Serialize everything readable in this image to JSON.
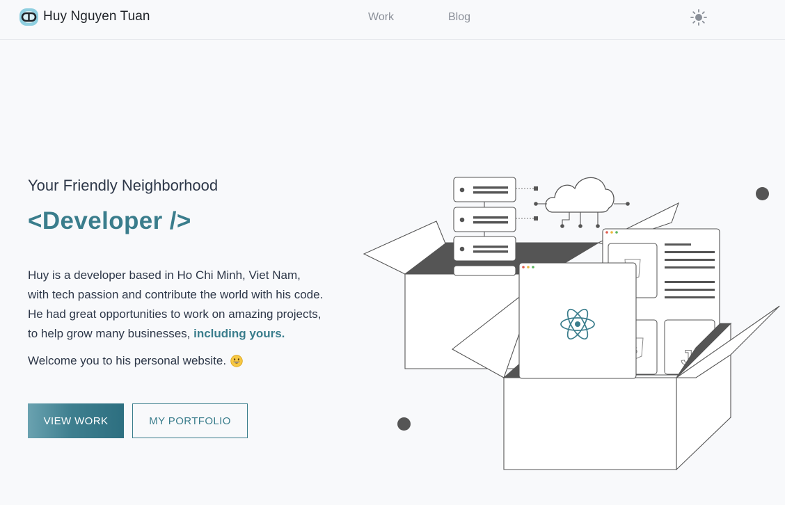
{
  "nav": {
    "brand_name": "Huy Nguyen Tuan",
    "links": [
      {
        "label": "Work"
      },
      {
        "label": "Blog"
      }
    ]
  },
  "hero": {
    "eyebrow": "Your Friendly Neighborhood",
    "title": "<Developer />",
    "description": {
      "line1": "Huy is a developer based in Ho Chi Minh, Viet Nam,",
      "line2": "with tech passion and contribute the world with his code.",
      "line3": "He had great opportunities to work on amazing projects,",
      "line4_prefix": "to help grow many businesses, ",
      "line4_highlight": "including yours."
    },
    "welcome": "Welcome you to his personal website.",
    "buttons": {
      "primary": "VIEW WORK",
      "secondary": "MY PORTFOLIO"
    }
  },
  "illustration": {
    "js_label": "JS",
    "html_label": "5"
  },
  "colors": {
    "accent": "#3a7d8c",
    "text": "#2d3748",
    "muted": "#8a8f98",
    "background": "#f8f9fb"
  },
  "icons": {
    "brand": "brand-logo-icon",
    "theme": "sun-icon",
    "emoji": "grinning-face-icon"
  }
}
